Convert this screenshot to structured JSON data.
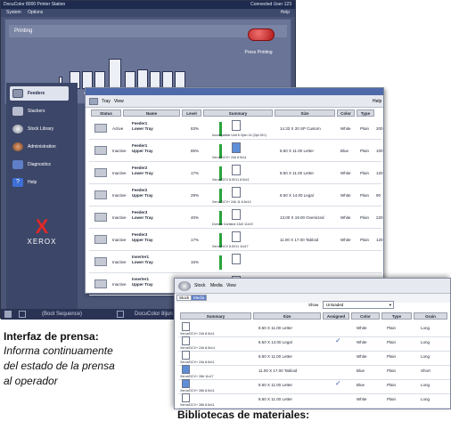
{
  "console": {
    "title": "DocuColor 8000 Printer Station",
    "title_right": "Connected User 123",
    "menu": [
      "System",
      "Options"
    ],
    "help": "Help",
    "panel_header": "Printing",
    "press_status": "Press Printing",
    "machine_labels": [
      "FNIP",
      "Fe...",
      "Fe...",
      "Fe...",
      "Fold Engine",
      "Iu...",
      "Ite...",
      "Ite...",
      "Ite..."
    ],
    "accent_color": "#c91e1e"
  },
  "sidebar": {
    "items": [
      {
        "label": "Feeders",
        "icon": "tray-icon"
      },
      {
        "label": "Stackers",
        "icon": "stacker-icon"
      },
      {
        "label": "Stock Library",
        "icon": "stock-library-icon"
      },
      {
        "label": "Administration",
        "icon": "admin-icon"
      },
      {
        "label": "Diagnostics",
        "icon": "diagnostics-icon"
      },
      {
        "label": "Help",
        "icon": "help-icon"
      }
    ],
    "logo_text": "XEROX"
  },
  "statusbar": {
    "left": "(Boot Sequence)",
    "right": "DocuColor 8ijun"
  },
  "tray_window": {
    "title": "Tray View",
    "menu": [
      "Tray",
      "View"
    ],
    "help": "Help",
    "columns": [
      "Status",
      "Name",
      "Level",
      "Summary",
      "Size",
      "Color",
      "Type",
      "Weight"
    ],
    "rows": [
      {
        "status": "Active",
        "name": "Feeder1\nLower Tray",
        "level": "83%",
        "summary": "Incompatible Unit 6 Optn 14 (Opt 28 t)",
        "size": "14.33 X 20 SP Custom",
        "color": "White",
        "type": "Plain",
        "weight": "200"
      },
      {
        "status": "Inactive",
        "name": "Feeder1\nUpper Tray",
        "level": "85%",
        "summary": "Xerox/DCV+ 24# 8.5x11",
        "size": "8.50 X 11.00 Letter",
        "color": "Blue",
        "type": "Plain",
        "weight": "100"
      },
      {
        "status": "Inactive",
        "name": "Feeder2\nLower Tray",
        "level": "17%",
        "summary": "Xerox/DCV 8.5X11 8.5x11",
        "size": "8.50 X 11.00 Letter",
        "color": "White",
        "type": "Plain",
        "weight": "120"
      },
      {
        "status": "Inactive",
        "name": "Feeder2\nUpper Tray",
        "level": "29%",
        "summary": "Xerox/DCV+ 24# 11 8.5x14",
        "size": "8.50 X 14.00 Legal",
        "color": "White",
        "type": "Plain",
        "weight": "90"
      },
      {
        "status": "Inactive",
        "name": "Feeder3\nLower Tray",
        "level": "40%",
        "summary": "Domtar Cortland 13x0 11x19",
        "size": "13.00 X 19.00 Oversized",
        "color": "White",
        "type": "Plain",
        "weight": "220"
      },
      {
        "status": "Inactive",
        "name": "Feeder3\nUpper Tray",
        "level": "17%",
        "summary": "Xerox/DCV 8.5X11 11x17",
        "size": "11.00 X 17.00 Tabloid",
        "color": "White",
        "type": "Plain",
        "weight": "120"
      },
      {
        "status": "Inactive",
        "name": "Inserter1\nLower Tray",
        "level": "16%",
        "summary": "",
        "size": "",
        "color": "",
        "type": "",
        "weight": ""
      },
      {
        "status": "Inactive",
        "name": "Inserter1\nUpper Tray",
        "level": "",
        "summary": "",
        "size": "",
        "color": "",
        "type": "",
        "weight": ""
      }
    ]
  },
  "stock_window": {
    "title": "Stock Media View",
    "menu": [
      "Stock",
      "Media",
      "View"
    ],
    "tabs": [
      "Stock",
      "Media"
    ],
    "show_label": "Show",
    "show_value": "Unloaded",
    "columns": [
      "Summary",
      "Size",
      "Assigned",
      "Color",
      "Type",
      "Grain"
    ],
    "rows": [
      {
        "summary": "Xerox/DCV+ 24# 8.5x11",
        "size": "8.50 X 11.00 Letter",
        "assigned": false,
        "color": "White",
        "type": "Plain",
        "grain": "Long"
      },
      {
        "summary": "Xerox/DCV+ 24# 8.5x14",
        "size": "8.50 X 14.00 Legal",
        "assigned": true,
        "color": "White",
        "type": "Plain",
        "grain": "Long"
      },
      {
        "summary": "Xerox/DCV+ 24# 8.5x11",
        "size": "8.50 X 11.00 Letter",
        "assigned": false,
        "color": "White",
        "type": "Plain",
        "grain": "Long"
      },
      {
        "summary": "Xerox/DCV+ 28# 11x17",
        "size": "11.00 X 17.00 Tabloid",
        "assigned": false,
        "color": "Blue",
        "type": "Plain",
        "grain": "Short"
      },
      {
        "summary": "Xerox/DCV+ 28# 8.5x11",
        "size": "8.50 X 11.00 Letter",
        "assigned": true,
        "color": "Blue",
        "type": "Plain",
        "grain": "Long"
      },
      {
        "summary": "Xerox/DCV+ 28# 8.5x11",
        "size": "8.50 X 11.00 Letter",
        "assigned": false,
        "color": "White",
        "type": "Plain",
        "grain": "Long"
      }
    ],
    "check_mark": "✓"
  },
  "captions": {
    "press_title": "Interfaz de prensa:",
    "press_body_1": "Informa continuamente",
    "press_body_2": "del estado de la prensa",
    "press_body_3": "al operador",
    "library_title": "Bibliotecas de materiales:"
  }
}
